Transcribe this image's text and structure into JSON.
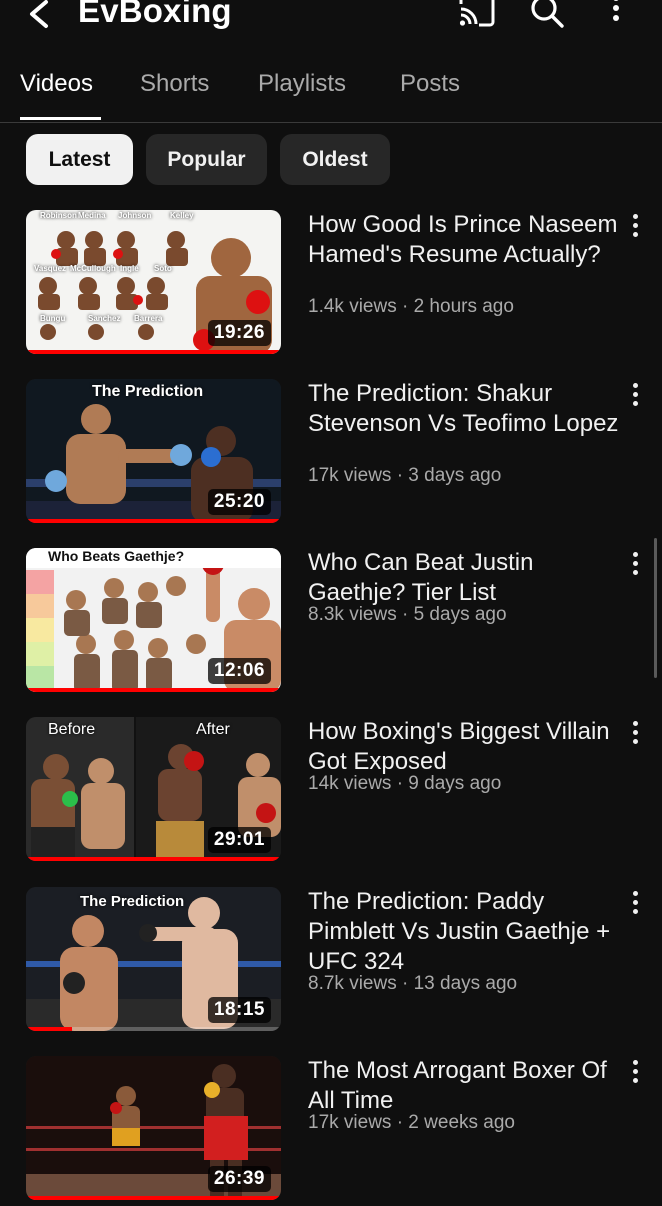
{
  "header": {
    "title": "EvBoxing"
  },
  "tabs": [
    {
      "label": "Videos",
      "active": true
    },
    {
      "label": "Shorts",
      "active": false
    },
    {
      "label": "Playlists",
      "active": false
    },
    {
      "label": "Posts",
      "active": false
    }
  ],
  "filters": [
    {
      "label": "Latest",
      "active": true
    },
    {
      "label": "Popular",
      "active": false
    },
    {
      "label": "Oldest",
      "active": false
    }
  ],
  "videos": [
    {
      "title": "How Good Is Prince Naseem Hamed's Resume Actually?",
      "meta": "1.4k views · 2 hours ago",
      "duration": "19:26",
      "watched": 1.0,
      "thumb_labels": [
        "Robinson",
        "Medina",
        "Johnson",
        "Kelley",
        "Vasquez",
        "McCullough",
        "Ingle",
        "Soto",
        "Bungu",
        "Sanchez",
        "Barrera"
      ]
    },
    {
      "title": "The Prediction: Shakur Stevenson Vs Teofimo Lopez",
      "meta": "17k views · 3 days ago",
      "duration": "25:20",
      "watched": 1.0,
      "thumb_labels": [
        "The Prediction"
      ]
    },
    {
      "title": "Who Can Beat Justin Gaethje? Tier List",
      "meta": "8.3k views · 5 days ago",
      "duration": "12:06",
      "watched": 1.0,
      "thumb_labels": [
        "Who Beats Gaethje?"
      ]
    },
    {
      "title": "How Boxing's Biggest Villain Got Exposed",
      "meta": "14k views · 9 days ago",
      "duration": "29:01",
      "watched": 1.0,
      "thumb_labels": [
        "Before",
        "After"
      ]
    },
    {
      "title": "The Prediction: Paddy Pimblett Vs Justin Gaethje + UFC 324",
      "meta": "8.7k views · 13 days ago",
      "duration": "18:15",
      "watched": 0.18,
      "thumb_labels": [
        "The Prediction"
      ]
    },
    {
      "title": "The Most Arrogant Boxer Of All Time",
      "meta": "17k views · 2 weeks ago",
      "duration": "26:39",
      "watched": 1.0,
      "thumb_labels": []
    }
  ],
  "icons": [
    "back-arrow-icon",
    "cast-icon",
    "search-icon",
    "more-vert-icon"
  ],
  "colors": {
    "background": "#0f0f0f",
    "progress": "#ff0000",
    "chip": "#272727",
    "chip_active": "#f1f1f1",
    "secondary_text": "#aaaaaa"
  }
}
